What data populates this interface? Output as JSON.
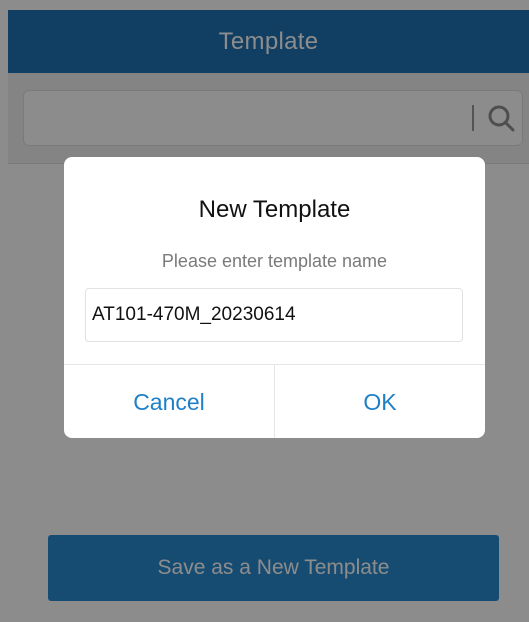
{
  "header": {
    "title": "Template"
  },
  "search": {
    "value": "",
    "icon": "search-icon"
  },
  "main": {
    "save_button_label": "Save as a  New Template"
  },
  "dialog": {
    "title": "New Template",
    "message": "Please enter template name",
    "input_value": "AT101-470M_20230614",
    "cancel_label": "Cancel",
    "ok_label": "OK"
  },
  "colors": {
    "header": "#1e73b4",
    "accent": "#1f80c8",
    "overlay": "rgba(0,0,0,0.45)"
  }
}
